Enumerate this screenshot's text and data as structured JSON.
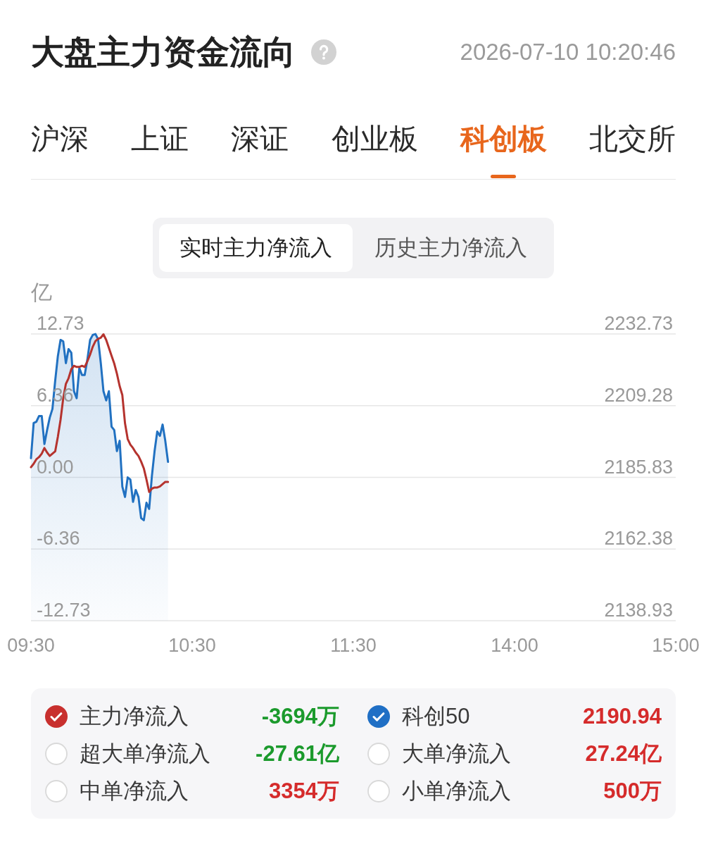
{
  "header": {
    "title": "大盘主力资金流向",
    "timestamp": "2026-07-10 10:20:46"
  },
  "tabs": [
    {
      "label": "沪深",
      "selected": false
    },
    {
      "label": "上证",
      "selected": false
    },
    {
      "label": "深证",
      "selected": false
    },
    {
      "label": "创业板",
      "selected": false
    },
    {
      "label": "科创板",
      "selected": true
    },
    {
      "label": "北交所",
      "selected": false
    }
  ],
  "view_toggle": [
    {
      "label": "实时主力净流入",
      "selected": true
    },
    {
      "label": "历史主力净流入",
      "selected": false
    }
  ],
  "chart": {
    "chart_data": {
      "type": "line",
      "ylabel": "亿",
      "grid": true,
      "categories": [
        "09:30",
        null,
        null,
        null,
        null,
        null,
        null,
        null,
        null,
        null,
        null,
        null,
        null,
        null,
        null,
        null,
        null,
        null,
        null,
        null,
        null,
        null,
        null,
        null,
        null,
        null,
        null,
        null,
        null,
        null,
        null,
        null,
        null,
        null,
        null,
        null,
        null,
        null,
        null,
        null,
        null,
        null,
        null,
        null,
        null,
        null,
        null,
        null,
        null,
        null,
        null,
        null,
        null,
        null,
        null,
        null,
        null,
        null,
        null,
        null,
        "10:30",
        null,
        null,
        null,
        null,
        null,
        null,
        null,
        null,
        null,
        null,
        null,
        null,
        null,
        null,
        null,
        null,
        null,
        null,
        null,
        null,
        null,
        null,
        null,
        null,
        null,
        null,
        null,
        null,
        null,
        null,
        null,
        null,
        null,
        null,
        null,
        null,
        null,
        null,
        null,
        null,
        null,
        null,
        null,
        null,
        null,
        null,
        null,
        null,
        null,
        null,
        null,
        null,
        null,
        null,
        null,
        null,
        null,
        null,
        null,
        "11:30",
        null,
        null,
        null,
        null,
        null,
        null,
        null,
        null,
        null,
        null,
        null,
        null,
        null,
        null,
        null,
        null,
        null,
        null,
        null,
        null,
        null,
        null,
        null,
        null,
        null,
        null,
        null,
        null,
        null,
        null,
        null,
        null,
        null,
        null,
        null,
        null,
        null,
        null,
        null,
        null,
        null,
        null,
        null,
        null,
        null,
        null,
        null,
        null,
        null,
        null,
        null,
        null,
        null,
        null,
        null,
        null,
        null,
        null,
        null,
        "14:00",
        null,
        null,
        null,
        null,
        null,
        null,
        null,
        null,
        null,
        null,
        null,
        null,
        null,
        null,
        null,
        null,
        null,
        null,
        null,
        null,
        null,
        null,
        null,
        null,
        null,
        null,
        null,
        null,
        null,
        null,
        null,
        null,
        null,
        null,
        null,
        null,
        null,
        null,
        null,
        null,
        null,
        null,
        null,
        null,
        null,
        null,
        null,
        null,
        null,
        null,
        null,
        null,
        null,
        null,
        null,
        null,
        null,
        null,
        null,
        "15:00"
      ],
      "ylim": [
        -12.73,
        12.73
      ],
      "yticks": [
        12.73,
        6.36,
        {
          "value": 0,
          "label": "0.00"
        },
        -6.36,
        -12.73
      ],
      "y2lim": [
        2138.93,
        2232.73
      ],
      "y2ticks": [
        2232.73,
        2209.28,
        2185.83,
        2162.38,
        2138.93
      ],
      "series": [
        {
          "color": "#2171c1",
          "axis": "y2",
          "type": "area",
          "values": [
            2192.1,
            2203.6,
            2204.0,
            2205.9,
            2205.9,
            2196.7,
            2201.3,
            2205.4,
            2208.2,
            2217.4,
            2225.5,
            2230.8,
            2230.3,
            2223.2,
            2227.8,
            2226.6,
            2214.0,
            2211.7,
            2221.6,
            2219.3,
            2219.3,
            2224.3,
            2230.8,
            2232.4,
            2232.7,
            2231.0,
            2223.2,
            2214.0,
            2211.0,
            2214.0,
            2202.4,
            2201.3,
            2194.4,
            2197.8,
            2182.8,
            2179.4,
            2185.8,
            2185.1,
            2177.8,
            2181.7,
            2179.4,
            2172.5,
            2171.8,
            2177.5,
            2175.5,
            2186.3,
            2194.4,
            2200.8,
            2199.4,
            2203.1,
            2197.8,
            2190.9,
            null,
            null,
            null,
            null,
            null,
            null,
            null,
            null,
            null,
            null,
            null,
            null,
            null,
            null,
            null,
            null,
            null,
            null,
            null,
            null,
            null,
            null,
            null,
            null,
            null,
            null,
            null,
            null,
            null,
            null,
            null,
            null,
            null,
            null,
            null,
            null,
            null,
            null,
            null,
            null,
            null,
            null,
            null,
            null,
            null,
            null,
            null,
            null,
            null,
            null,
            null,
            null,
            null,
            null,
            null,
            null,
            null,
            null,
            null,
            null,
            null,
            null,
            null,
            null,
            null,
            null,
            null,
            null,
            null,
            null,
            null,
            null,
            null,
            null,
            null,
            null,
            null,
            null,
            null,
            null,
            null,
            null,
            null,
            null,
            null,
            null,
            null,
            null,
            null,
            null,
            null,
            null,
            null,
            null,
            null,
            null,
            null,
            null,
            null,
            null,
            null,
            null,
            null,
            null,
            null,
            null,
            null,
            null,
            null,
            null,
            null,
            null,
            null,
            null,
            null,
            null,
            null,
            null,
            null,
            null,
            null,
            null,
            null,
            null,
            null,
            null,
            null,
            null,
            null,
            null,
            null,
            null,
            null,
            null,
            null,
            null,
            null,
            null,
            null,
            null,
            null,
            null,
            null,
            null,
            null,
            null,
            null,
            null,
            null,
            null,
            null,
            null,
            null,
            null,
            null,
            null,
            null,
            null,
            null,
            null,
            null,
            null,
            null,
            null,
            null,
            null,
            null,
            null,
            null,
            null,
            null,
            null,
            null,
            null,
            null,
            null,
            null,
            null,
            null,
            null,
            null,
            null,
            null,
            null,
            null,
            null,
            null,
            null,
            null
          ]
        },
        {
          "color": "#b5332e",
          "values": [
            0.9,
            1.2,
            1.6,
            1.8,
            2.1,
            2.6,
            2.2,
            1.9,
            2.1,
            2.3,
            3.6,
            5.1,
            7,
            8.3,
            8.8,
            9.6,
            9.9,
            9.8,
            9.8,
            9.9,
            9.8,
            10.3,
            10.9,
            11.6,
            12.1,
            12.3,
            12.4,
            12.7,
            12.2,
            11.5,
            10.8,
            10.1,
            9.2,
            8.1,
            7.3,
            4.8,
            3.4,
            2.9,
            2.6,
            2.2,
            1.9,
            1.4,
            0.8,
            -0.2,
            -1.3,
            -1,
            -0.9,
            -0.9,
            -0.8,
            -0.6,
            -0.4,
            -0.4,
            null,
            null,
            null,
            null,
            null,
            null,
            null,
            null,
            null,
            null,
            null,
            null,
            null,
            null,
            null,
            null,
            null,
            null,
            null,
            null,
            null,
            null,
            null,
            null,
            null,
            null,
            null,
            null,
            null,
            null,
            null,
            null,
            null,
            null,
            null,
            null,
            null,
            null,
            null,
            null,
            null,
            null,
            null,
            null,
            null,
            null,
            null,
            null,
            null,
            null,
            null,
            null,
            null,
            null,
            null,
            null,
            null,
            null,
            null,
            null,
            null,
            null,
            null,
            null,
            null,
            null,
            null,
            null,
            null,
            null,
            null,
            null,
            null,
            null,
            null,
            null,
            null,
            null,
            null,
            null,
            null,
            null,
            null,
            null,
            null,
            null,
            null,
            null,
            null,
            null,
            null,
            null,
            null,
            null,
            null,
            null,
            null,
            null,
            null,
            null,
            null,
            null,
            null,
            null,
            null,
            null,
            null,
            null,
            null,
            null,
            null,
            null,
            null,
            null,
            null,
            null,
            null,
            null,
            null,
            null,
            null,
            null,
            null,
            null,
            null,
            null,
            null,
            null,
            null,
            null,
            null,
            null,
            null,
            null,
            null,
            null,
            null,
            null,
            null,
            null,
            null,
            null,
            null,
            null,
            null,
            null,
            null,
            null,
            null,
            null,
            null,
            null,
            null,
            null,
            null,
            null,
            null,
            null,
            null,
            null,
            null,
            null,
            null,
            null,
            null,
            null,
            null,
            null,
            null,
            null,
            null,
            null,
            null,
            null,
            null,
            null,
            null,
            null,
            null,
            null,
            null,
            null,
            null,
            null,
            null,
            null,
            null,
            null,
            null
          ]
        }
      ]
    }
  },
  "legend": {
    "items": [
      {
        "label": "主力净流入",
        "value": "-3694万",
        "rising": false,
        "checked": true,
        "color": "#c8302e"
      },
      {
        "label": "科创50",
        "value": "2190.94",
        "rising": true,
        "checked": true,
        "color": "#1f6fc5"
      },
      {
        "label": "超大单净流入",
        "value": "-27.61亿",
        "rising": false,
        "checked": false
      },
      {
        "label": "大单净流入",
        "value": "27.24亿",
        "rising": true,
        "checked": false
      },
      {
        "label": "中单净流入",
        "value": "3354万",
        "rising": true,
        "checked": false
      },
      {
        "label": "小单净流入",
        "value": "500万",
        "rising": true,
        "checked": false
      }
    ]
  }
}
